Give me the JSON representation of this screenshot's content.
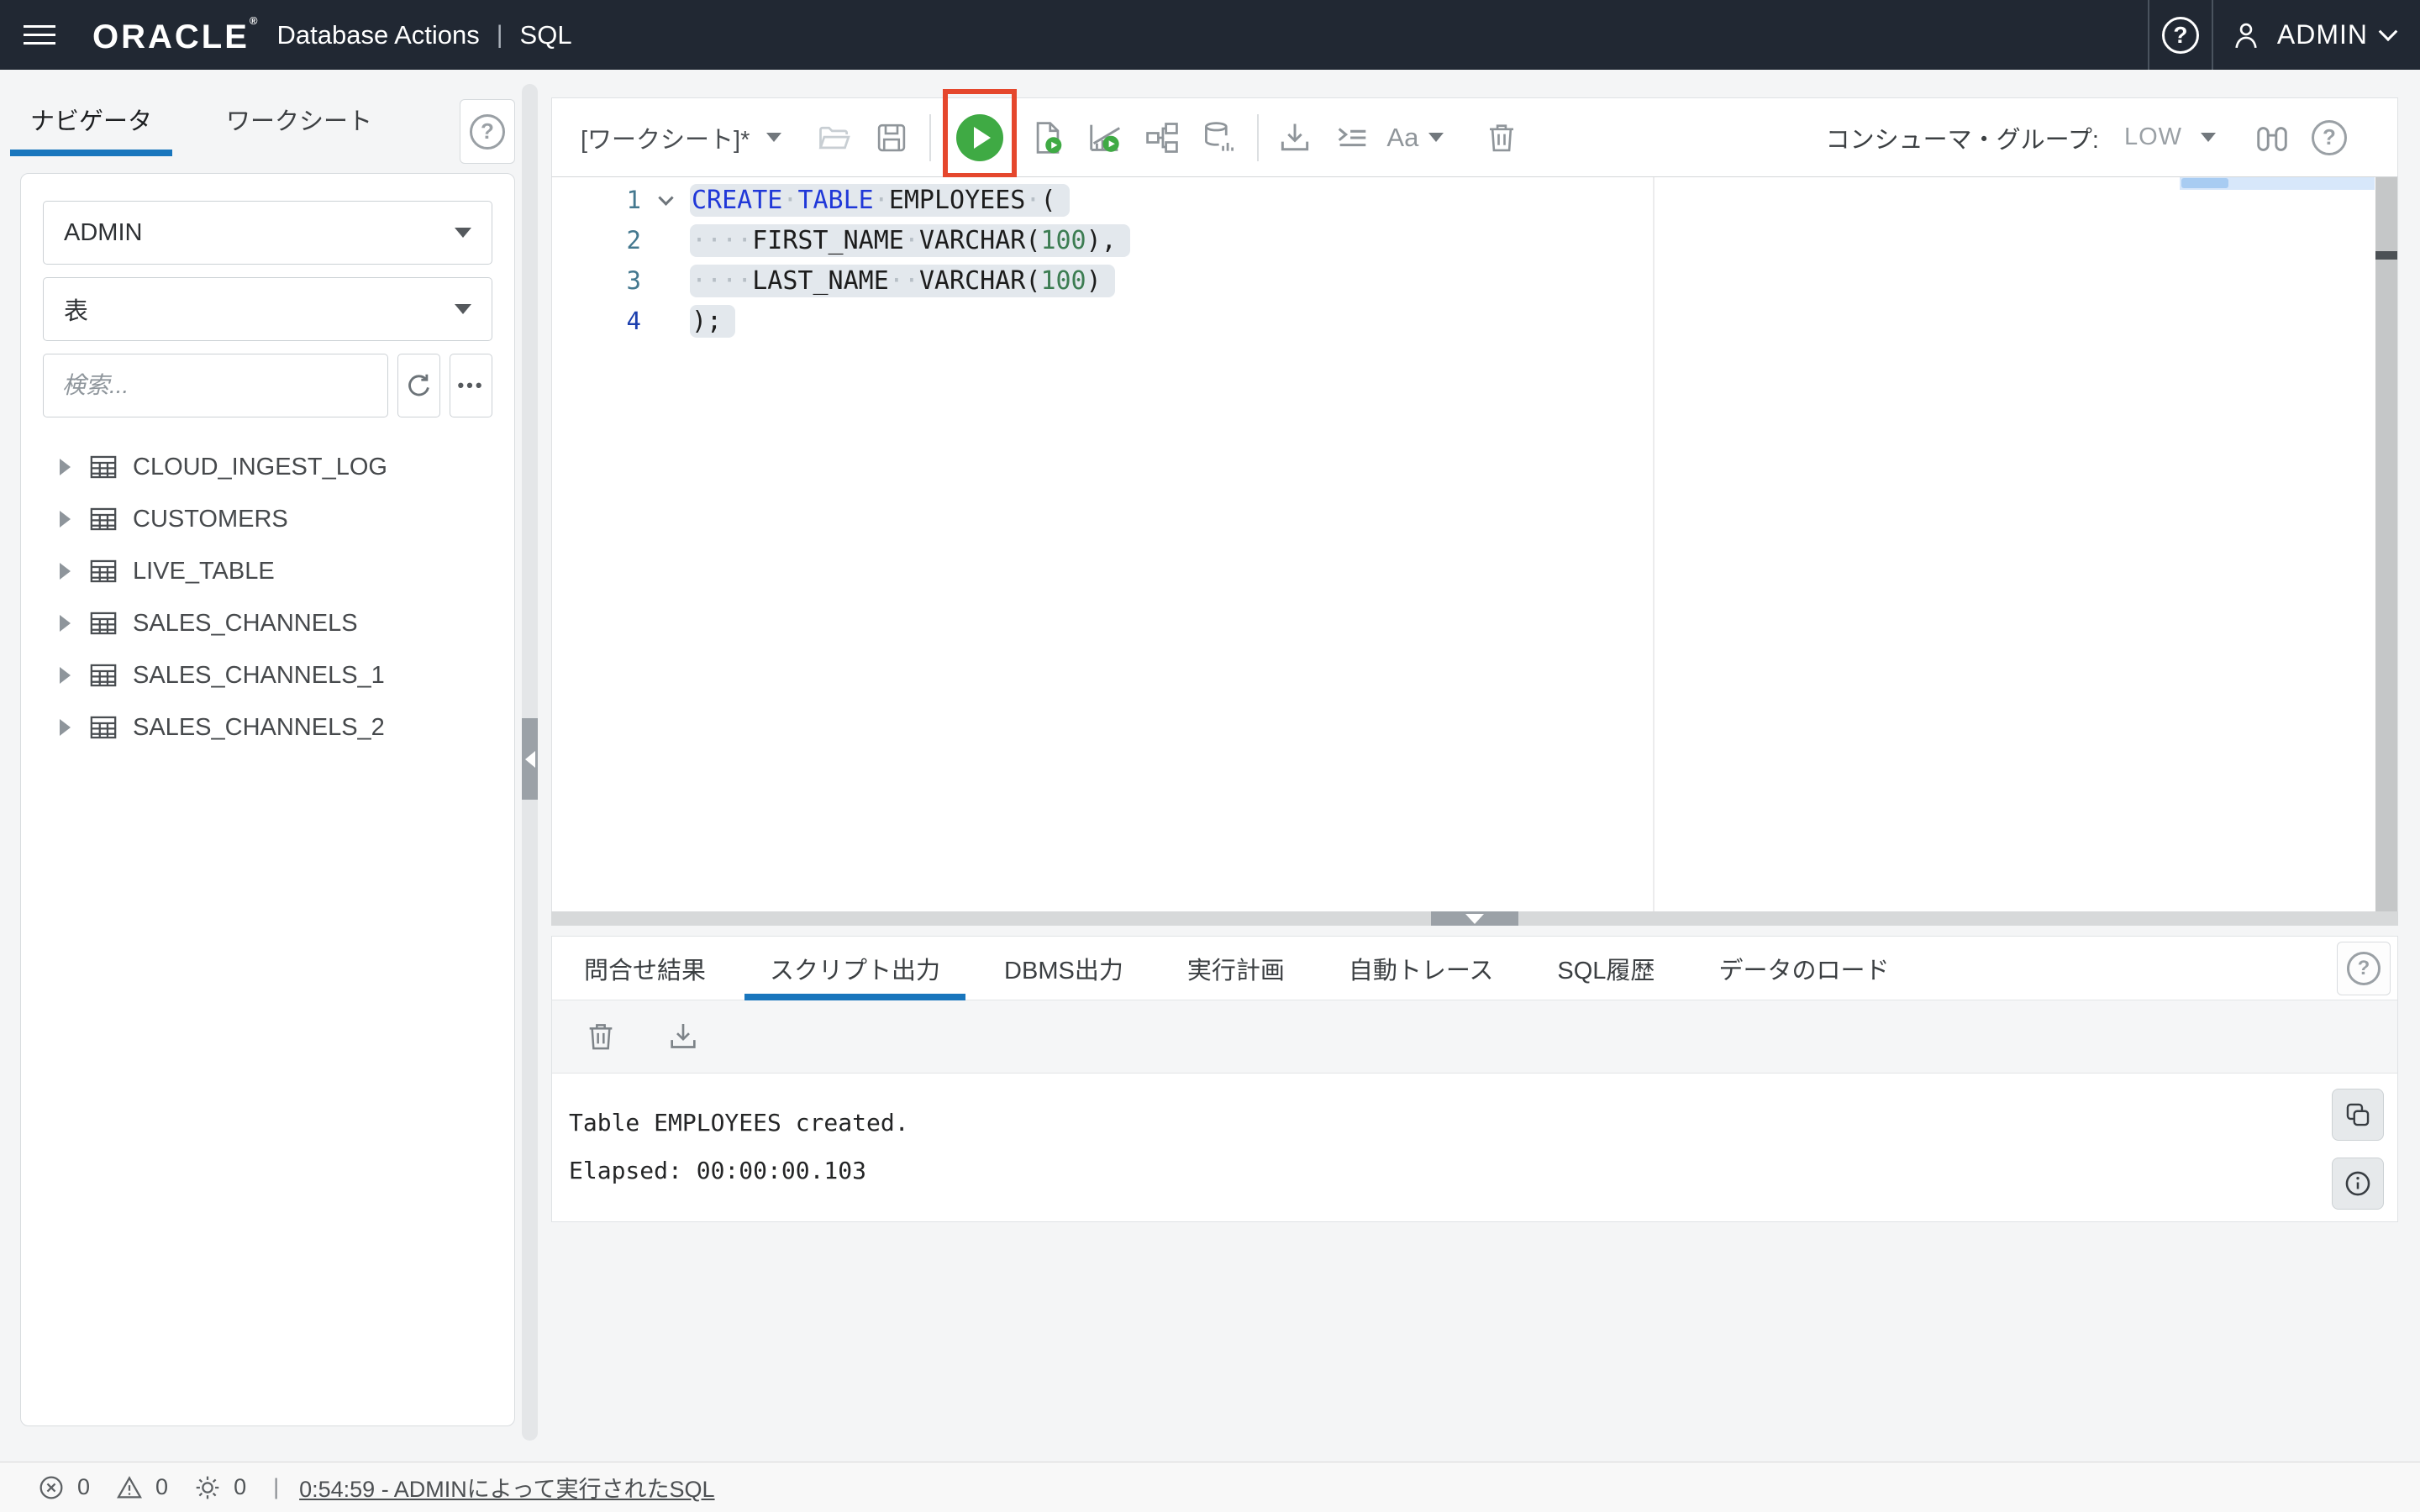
{
  "colors": {
    "header_bg": "#212833",
    "accent_blue": "#1976bd",
    "run_green": "#3faa44",
    "highlight_red": "#e5472d",
    "keyword_blue": "#2038d8",
    "number_green": "#3c7d52",
    "selection_bg": "#e3e8ed"
  },
  "icons": {
    "header": [
      "hamburger-icon",
      "help-icon",
      "user-icon",
      "chevron-down-icon"
    ],
    "toolbar": [
      "open-folder-icon",
      "save-icon",
      "run-icon",
      "run-script-icon",
      "autotrace-run-icon",
      "explain-plan-icon",
      "db-stats-icon",
      "download-icon",
      "format-icon",
      "font-size-icon",
      "clear-icon",
      "binoculars-icon",
      "help-icon"
    ],
    "sidebar": [
      "help-icon",
      "dropdown-caret-icon",
      "refresh-icon",
      "more-icon",
      "expand-caret-icon",
      "table-icon"
    ],
    "results": [
      "trash-icon",
      "download-icon",
      "copy-icon",
      "info-icon",
      "help-icon"
    ],
    "statusbar": [
      "error-circle-icon",
      "warning-triangle-icon",
      "gear-icon"
    ]
  },
  "header": {
    "brand": "ORACLE",
    "brand_registered": "®",
    "app_title": "Database Actions",
    "divider": "|",
    "module": "SQL",
    "user": "ADMIN"
  },
  "sidebar": {
    "tabs": [
      {
        "label": "ナビゲータ",
        "active": true
      },
      {
        "label": "ワークシート",
        "active": false
      }
    ],
    "schema_select": "ADMIN",
    "object_type_select": "表",
    "search_placeholder": "検索...",
    "more_label": "•••",
    "tree": [
      "CLOUD_INGEST_LOG",
      "CUSTOMERS",
      "LIVE_TABLE",
      "SALES_CHANNELS",
      "SALES_CHANNELS_1",
      "SALES_CHANNELS_2"
    ]
  },
  "toolbar": {
    "worksheet_label": "[ワークシート]*",
    "font_button_label": "Aa",
    "consumer_group_label": "コンシューマ・グループ:",
    "consumer_group_value": "LOW"
  },
  "editor": {
    "lines": [
      {
        "num": "1",
        "fold": true,
        "cursor": false,
        "selected": true,
        "tokens": [
          {
            "t": "CREATE",
            "c": "kw"
          },
          {
            "t": "·",
            "c": "ws"
          },
          {
            "t": "TABLE",
            "c": "kw"
          },
          {
            "t": "·",
            "c": "ws"
          },
          {
            "t": "EMPLOYEES",
            "c": "id"
          },
          {
            "t": "·",
            "c": "ws"
          },
          {
            "t": "(",
            "c": "id"
          }
        ]
      },
      {
        "num": "2",
        "fold": false,
        "cursor": false,
        "selected": true,
        "tokens": [
          {
            "t": "····",
            "c": "ws"
          },
          {
            "t": "FIRST_NAME",
            "c": "id"
          },
          {
            "t": "·",
            "c": "ws"
          },
          {
            "t": "VARCHAR(",
            "c": "id"
          },
          {
            "t": "100",
            "c": "num"
          },
          {
            "t": "),",
            "c": "id"
          }
        ]
      },
      {
        "num": "3",
        "fold": false,
        "cursor": false,
        "selected": true,
        "tokens": [
          {
            "t": "····",
            "c": "ws"
          },
          {
            "t": "LAST_NAME",
            "c": "id"
          },
          {
            "t": "··",
            "c": "ws"
          },
          {
            "t": "VARCHAR(",
            "c": "id"
          },
          {
            "t": "100",
            "c": "num"
          },
          {
            "t": ")",
            "c": "id"
          }
        ]
      },
      {
        "num": "4",
        "fold": false,
        "cursor": true,
        "selected": true,
        "tokens": [
          {
            "t": ");",
            "c": "id"
          }
        ]
      }
    ]
  },
  "results": {
    "tabs": [
      "問合せ結果",
      "スクリプト出力",
      "DBMS出力",
      "実行計画",
      "自動トレース",
      "SQL履歴",
      "データのロード"
    ],
    "active_tab": "スクリプト出力",
    "output_lines": [
      "Table EMPLOYEES created.",
      "Elapsed: 00:00:00.103"
    ]
  },
  "statusbar": {
    "errors": "0",
    "warnings": "0",
    "processes": "0",
    "divider": "|",
    "history_link": "0:54:59 - ADMINによって実行されたSQL"
  }
}
